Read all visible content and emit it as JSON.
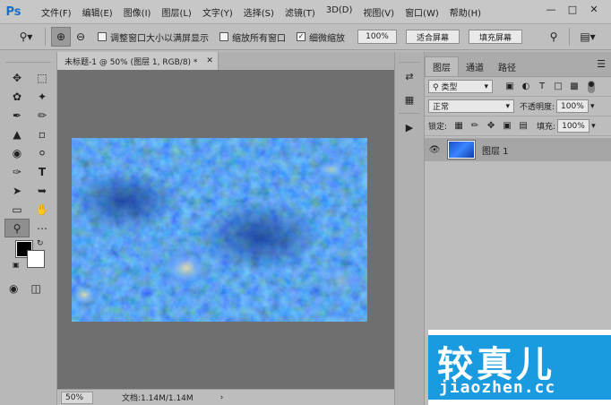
{
  "app": {
    "logo": "Ps",
    "menu": [
      "文件(F)",
      "编辑(E)",
      "图像(I)",
      "图层(L)",
      "文字(Y)",
      "选择(S)",
      "滤镜(T)",
      "3D(D)",
      "视图(V)",
      "窗口(W)",
      "帮助(H)"
    ],
    "window_controls": [
      "minimize-icon",
      "maximize-icon",
      "close-icon"
    ]
  },
  "options": {
    "resize_windows_label": "调整窗口大小以满屏显示",
    "resize_windows_checked": false,
    "zoom_all_label": "缩放所有窗口",
    "zoom_all_checked": false,
    "scrubby_label": "细微缩放",
    "scrubby_checked": true,
    "zoom_100": "100%",
    "fit_screen": "适合屏幕",
    "fill_screen": "填充屏幕"
  },
  "document": {
    "tab_title": "未标题-1 @ 50% (图层 1, RGB/8) *",
    "zoom": "50%",
    "doc_info": "文档:1.14M/1.14M"
  },
  "layers_panel": {
    "tabs": [
      "图层",
      "通道",
      "路径"
    ],
    "active_tab": "图层",
    "filter_kind": "类型",
    "blend_mode": "正常",
    "opacity_label": "不透明度:",
    "opacity_value": "100%",
    "lock_label": "锁定:",
    "fill_label": "填充:",
    "fill_value": "100%",
    "layers": [
      {
        "name": "图层 1",
        "visible": true
      }
    ]
  },
  "watermark": {
    "title": "较真儿",
    "url": "jiaozhen.cc"
  },
  "colors": {
    "foreground": "#000000",
    "background": "#ffffff",
    "image_blue": "#1b4fc7"
  }
}
